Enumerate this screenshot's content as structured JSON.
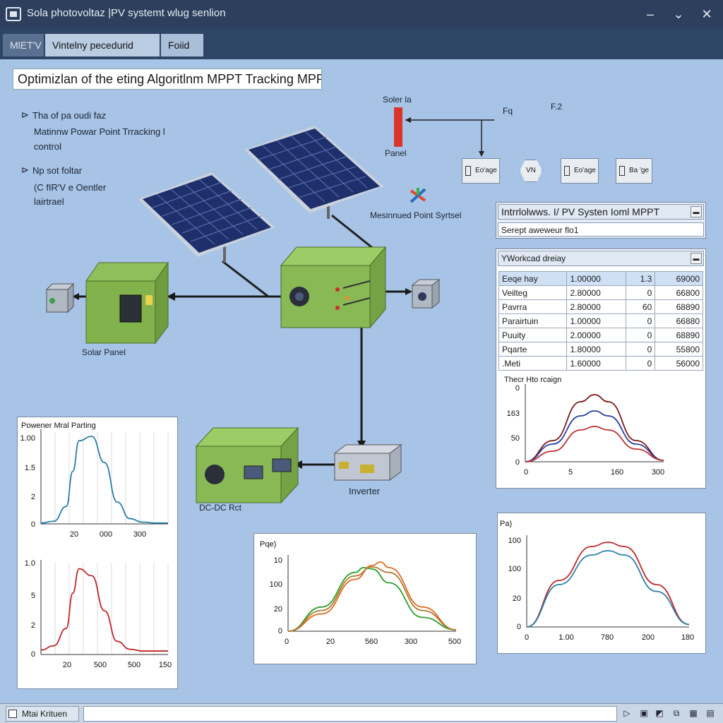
{
  "window": {
    "title": "Sola photovoltaz |PV systemt wlug senlion",
    "close_glyph": "✕",
    "minimize_glyph": "‒",
    "restore_glyph": "⌄"
  },
  "tabs": [
    {
      "label": "MlET'V"
    },
    {
      "label": "Vintelny pecedurid elcom"
    },
    {
      "label": "Foiid"
    }
  ],
  "heading": "Optimizlan of the eting Algoritlnm MPPT Tracking MPPT)",
  "notes": {
    "line1": "Tha of pa oudi faz",
    "line2": "Matinnw Powar Point Trracking l",
    "line3": "control",
    "line4": "Np sot foltar",
    "line5": "(C fIR'V e Oentler",
    "line6": "lairtrael"
  },
  "diagram": {
    "solar_label": "Soler la",
    "panel_label": "Panel",
    "f1": "Fq",
    "f2": "F.2",
    "mppt_system": "Mesinnued Point Syrtsel",
    "solar_panel": "Solar Panel",
    "inverter": "Inverter",
    "dcdc": "DC-DC Rct",
    "box1": "Eo'age",
    "box2": "VN",
    "box3": "Eo'age",
    "box4": "Ba 'ge"
  },
  "intl_panel": {
    "title": "Intrrlolwws. I/ PV Systen Ioml MPPT",
    "input_value": "Serept aweweur flo1"
  },
  "workload_panel": {
    "title": "YWorkcad dreiay",
    "rows": [
      {
        "name": "Eeqe hay",
        "v1": "1.00000",
        "v2": "1.3",
        "v3": "69000"
      },
      {
        "name": "Veilteg",
        "v1": "2.80000",
        "v2": "0",
        "v3": "66800"
      },
      {
        "name": "Pavrra",
        "v1": "2.80000",
        "v2": "60",
        "v3": "68890"
      },
      {
        "name": "Parairtuin",
        "v1": "1.00000",
        "v2": "0",
        "v3": "66880"
      },
      {
        "name": "Puuity",
        "v1": "2.00000",
        "v2": "0",
        "v3": "68890"
      },
      {
        "name": "Pqarte",
        "v1": "1.80000",
        "v2": "0",
        "v3": "55800"
      },
      {
        "name": ".Meti",
        "v1": "1.60000",
        "v2": "0",
        "v3": "56000"
      }
    ]
  },
  "chart_data": [
    {
      "type": "line",
      "title": "Powener Mral Parting",
      "ytick_labels": [
        "1.00",
        "1.5",
        "2",
        "0"
      ],
      "xtick_labels": [
        "20",
        "000",
        "300"
      ],
      "series": [
        {
          "color": "#2a7fa8",
          "x": [
            0,
            10,
            20,
            25,
            30,
            40,
            50,
            60,
            70,
            80,
            90,
            100
          ],
          "y": [
            0.01,
            0.03,
            0.2,
            0.6,
            0.95,
            1.0,
            0.7,
            0.25,
            0.06,
            0.02,
            0.01,
            0.01
          ]
        }
      ]
    },
    {
      "type": "line",
      "title": "",
      "ytick_labels": [
        "1.0",
        "5",
        "2",
        "0"
      ],
      "xtick_labels": [
        "20",
        "500",
        "500",
        "150"
      ],
      "series": [
        {
          "color": "#c0282a",
          "x": [
            0,
            10,
            20,
            25,
            30,
            40,
            50,
            60,
            70,
            80,
            90,
            100
          ],
          "y": [
            0.05,
            0.1,
            0.3,
            0.7,
            0.98,
            0.9,
            0.5,
            0.15,
            0.06,
            0.04,
            0.04,
            0.04
          ]
        }
      ]
    },
    {
      "type": "line",
      "title": "Thecr Hto rcaign",
      "ytick_labels": [
        "0",
        "163",
        "50",
        "0"
      ],
      "xtick_labels": [
        "0",
        "5",
        "160",
        "300"
      ],
      "series": [
        {
          "color": "#7a1818",
          "x": [
            0,
            20,
            40,
            50,
            60,
            80,
            100
          ],
          "y": [
            0,
            0.3,
            0.85,
            0.95,
            0.85,
            0.3,
            0.02
          ]
        },
        {
          "color": "#2a3fa0",
          "x": [
            0,
            20,
            40,
            50,
            60,
            80,
            100
          ],
          "y": [
            0,
            0.25,
            0.65,
            0.72,
            0.65,
            0.25,
            0.02
          ]
        },
        {
          "color": "#c03030",
          "x": [
            0,
            20,
            40,
            50,
            60,
            80,
            100
          ],
          "y": [
            0,
            0.15,
            0.45,
            0.5,
            0.45,
            0.18,
            0.02
          ]
        }
      ]
    },
    {
      "type": "line",
      "title": "Pqe)",
      "ytick_labels": [
        "10",
        "100",
        "20",
        "0"
      ],
      "xtick_labels": [
        "0",
        "20",
        "560",
        "300",
        "500"
      ],
      "series": [
        {
          "color": "#2aa02a",
          "x": [
            0,
            20,
            40,
            45,
            50,
            60,
            80,
            100
          ],
          "y": [
            0,
            0.35,
            0.85,
            0.92,
            0.9,
            0.7,
            0.2,
            0.02
          ]
        },
        {
          "color": "#e06a20",
          "x": [
            0,
            20,
            40,
            50,
            55,
            60,
            80,
            100
          ],
          "y": [
            0,
            0.25,
            0.75,
            0.95,
            1.0,
            0.92,
            0.35,
            0.02
          ]
        },
        {
          "color": "#b07a30",
          "x": [
            0,
            20,
            40,
            50,
            60,
            80,
            100
          ],
          "y": [
            0,
            0.3,
            0.8,
            0.93,
            0.85,
            0.3,
            0.02
          ]
        }
      ]
    },
    {
      "type": "line",
      "title": "Pa)",
      "ytick_labels": [
        "100",
        "100",
        "20",
        "0"
      ],
      "xtick_labels": [
        "0",
        "1.00",
        "780",
        "200",
        "180"
      ],
      "series": [
        {
          "color": "#c0282a",
          "x": [
            0,
            20,
            40,
            50,
            60,
            80,
            100
          ],
          "y": [
            0,
            0.55,
            0.95,
            1.0,
            0.95,
            0.5,
            0.03
          ]
        },
        {
          "color": "#2a7fa8",
          "x": [
            0,
            20,
            40,
            50,
            60,
            80,
            100
          ],
          "y": [
            0,
            0.5,
            0.85,
            0.9,
            0.85,
            0.42,
            0.03
          ]
        }
      ]
    }
  ],
  "status": {
    "label": "Mtai Krituen",
    "icons": [
      "play-icon",
      "save-icon",
      "image-icon",
      "window-icon",
      "tiles-icon",
      "grid-icon",
      "table-icon"
    ]
  }
}
